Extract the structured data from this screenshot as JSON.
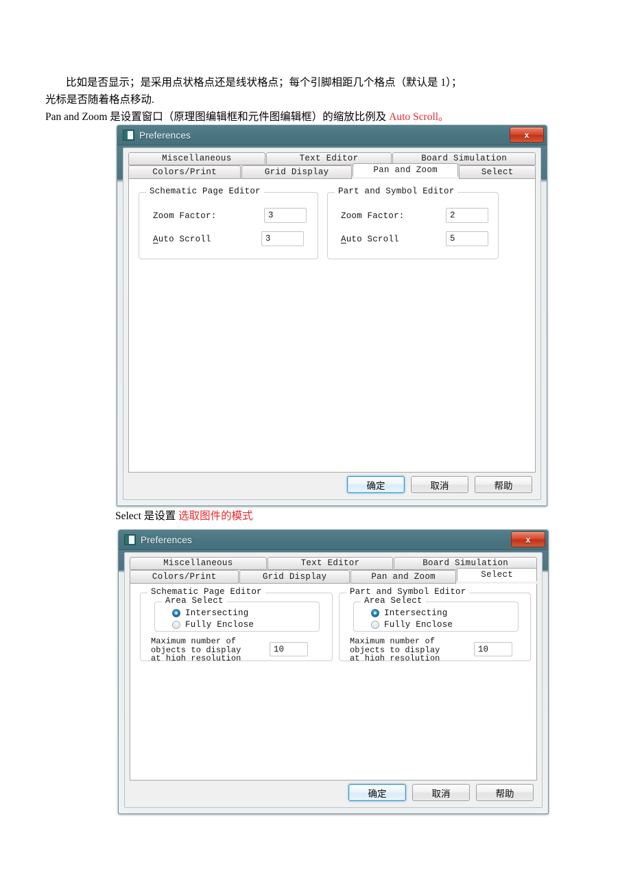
{
  "document": {
    "paragraph1_line1": "比如是否显示；是采用点状格点还是线状格点；每个引脚相距几个格点（默认是 1）；",
    "paragraph1_line2": "光标是否随着格点移动.",
    "paragraph2": "Pan and Zoom 是设置窗口（原理图编辑框和元件图编辑框）的缩放比例及 ",
    "paragraph2_red": "Auto Scroll。",
    "caption_select_black": "Select 是设置 ",
    "caption_select_red": "选取图件的模式"
  },
  "colors": {
    "accent_red": "#e8262b",
    "titlebar": "#4a7480",
    "close_button": "#bf3418",
    "default_button_border": "#3c94c9",
    "radio_selected": "#1c74ab"
  },
  "dialog1": {
    "title": "Preferences",
    "icon": "app-icon",
    "close_label": "x",
    "tabs_row1": [
      {
        "label": "Miscellaneous",
        "active": false
      },
      {
        "label": "Text Editor",
        "active": false
      },
      {
        "label": "Board Simulation",
        "active": false
      }
    ],
    "tabs_row2": [
      {
        "label": "Colors/Print",
        "active": false
      },
      {
        "label": "Grid Display",
        "active": false
      },
      {
        "label": "Pan and Zoom",
        "active": true
      },
      {
        "label": "Select",
        "active": false
      }
    ],
    "active_tab": "Pan and Zoom",
    "groups": [
      {
        "legend": "Schematic Page Editor",
        "zoom_factor_label": "Zoom Factor:",
        "zoom_factor_value": "3",
        "auto_scroll_label_accel": "A",
        "auto_scroll_label_rest": "uto Scroll",
        "auto_scroll_value": "3"
      },
      {
        "legend": "Part and Symbol Editor",
        "zoom_factor_label": "Zoom Factor:",
        "zoom_factor_value": "2",
        "auto_scroll_label_accel": "A",
        "auto_scroll_label_rest": "uto Scroll",
        "auto_scroll_value": "5"
      }
    ],
    "buttons": {
      "ok": "确定",
      "cancel": "取消",
      "help": "帮助"
    }
  },
  "dialog2": {
    "title": "Preferences",
    "icon": "app-icon",
    "close_label": "x",
    "tabs_row1": [
      {
        "label": "Miscellaneous",
        "active": false
      },
      {
        "label": "Text Editor",
        "active": false
      },
      {
        "label": "Board Simulation",
        "active": false
      }
    ],
    "tabs_row2": [
      {
        "label": "Colors/Print",
        "active": false
      },
      {
        "label": "Grid Display",
        "active": false
      },
      {
        "label": "Pan and Zoom",
        "active": false
      },
      {
        "label": "Select",
        "active": true
      }
    ],
    "active_tab": "Select",
    "groups": [
      {
        "legend": "Schematic Page Editor",
        "area_select_legend": "Area Select",
        "radio_intersecting": "Intersecting",
        "radio_fully_enclose": "Fully Enclose",
        "selected": "Intersecting",
        "max_objects_label": "Maximum number of\nobjects to display\nat high resolution\nwhile dragging",
        "max_objects_value": "10"
      },
      {
        "legend": "Part and Symbol Editor",
        "area_select_legend": "Area Select",
        "radio_intersecting": "Intersecting",
        "radio_fully_enclose": "Fully Enclose",
        "selected": "Intersecting",
        "max_objects_label": "Maximum number of\nobjects to display\nat high resolution\nwhile dragging",
        "max_objects_value": "10"
      }
    ],
    "buttons": {
      "ok": "确定",
      "cancel": "取消",
      "help": "帮助"
    }
  }
}
